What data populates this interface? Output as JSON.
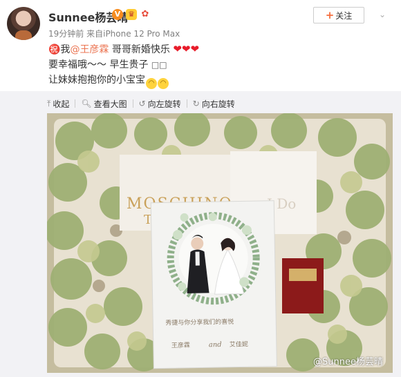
{
  "post": {
    "username": "Sunnee杨芸晴",
    "timestamp": "19分钟前",
    "source": "来自iPhone 12 Pro Max",
    "follow_label": "关注",
    "text": {
      "line1_prefix": "㊗️我",
      "mention": "@王彦霖",
      "line1_suffix": " 哥哥新婚快乐",
      "line2": "要幸福哦～～ 早生贵子",
      "line3": "让妹妹抱抱你的小宝宝"
    },
    "toolbar": {
      "collapse": "收起",
      "view_large": "查看大图",
      "rotate_left": "向左旋转",
      "rotate_right": "向右旋转"
    },
    "photo": {
      "box_left_text": "MOSCHINO",
      "box_left_text2": "TO",
      "box_right_text": "I Do",
      "card_line1": "秀捷与你分享我们的喜悦",
      "card_names_left": "王彦霖",
      "card_names_mid": "and",
      "card_names_right": "艾佳妮",
      "watermark": "@Sunnee杨芸晴"
    }
  }
}
